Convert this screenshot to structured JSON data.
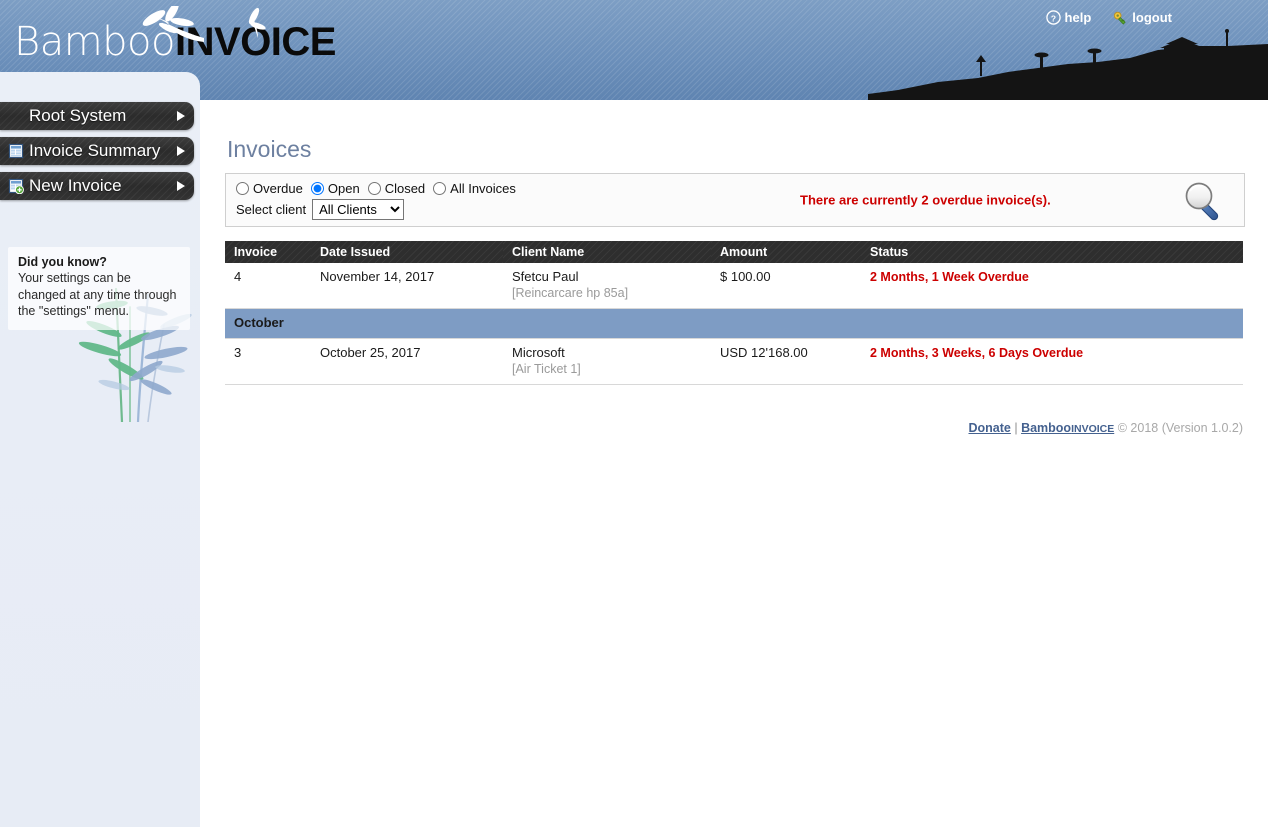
{
  "app": {
    "logo_primary": "Bamboo",
    "logo_secondary": "INVOICE"
  },
  "header": {
    "help_label": "help",
    "logout_label": "logout",
    "help_icon": "question-circle-icon",
    "logout_icon": "key-icon"
  },
  "sidebar": {
    "nav": [
      {
        "label": "Root System",
        "icon": "none"
      },
      {
        "label": "Invoice Summary",
        "icon": "report-icon"
      },
      {
        "label": "New Invoice",
        "icon": "report-add-icon"
      }
    ],
    "tip": {
      "title": "Did you know?",
      "body": "Your settings can be changed at any time through the \"settings\" menu."
    }
  },
  "main": {
    "title": "Invoices",
    "filters": {
      "radios": [
        {
          "label": "Overdue",
          "selected": false
        },
        {
          "label": "Open",
          "selected": true
        },
        {
          "label": "Closed",
          "selected": false
        },
        {
          "label": "All Invoices",
          "selected": false
        }
      ],
      "select_client_label": "Select client",
      "client_selected": "All Clients",
      "client_options": [
        "All Clients"
      ],
      "overdue_message": "There are currently 2 overdue invoice(s).",
      "search_icon": "magnifier-icon"
    },
    "table": {
      "columns": [
        "Invoice",
        "Date Issued",
        "Client Name",
        "Amount",
        "Status"
      ],
      "rows": [
        {
          "type": "invoice",
          "invoice": "4",
          "date": "November 14, 2017",
          "client": "Sfetcu Paul",
          "client_note": "[Reincarcare hp 85a]",
          "amount": "$ 100.00",
          "status": "2 Months, 1 Week Overdue"
        },
        {
          "type": "separator",
          "label": "October"
        },
        {
          "type": "invoice",
          "invoice": "3",
          "date": "October 25, 2017",
          "client": "Microsoft",
          "client_note": "[Air Ticket 1]",
          "amount": "USD 12'168.00",
          "status": "2 Months, 3 Weeks, 6 Days Overdue"
        }
      ]
    }
  },
  "footer": {
    "donate_label": "Donate",
    "separator": "|",
    "brand_primary": "Bamboo",
    "brand_secondary": "INVOICE",
    "copyright": "© 2018 (Version 1.0.2)"
  },
  "colors": {
    "banner_blue": "#7194bd",
    "nav_dark": "#2d2d2d",
    "title_slate": "#6d80a0",
    "overdue_red": "#cc0000",
    "month_bar": "#7e9cc4",
    "sidebar_bg": "#e8edf6"
  }
}
